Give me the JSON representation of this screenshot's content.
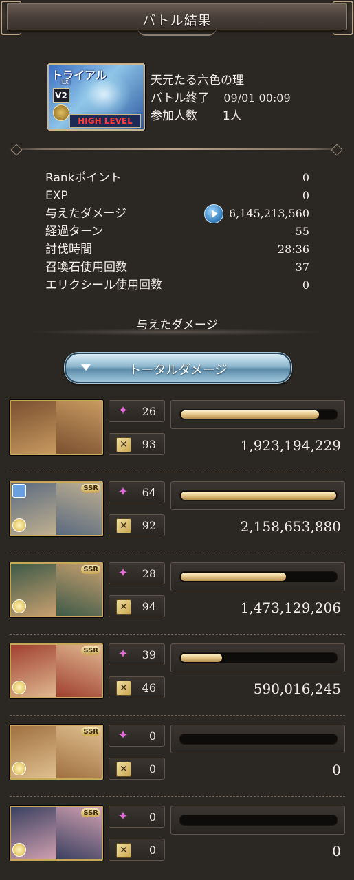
{
  "header": {
    "title": "バトル結果"
  },
  "quest": {
    "banner_trial": "トライアル",
    "banner_lx": "LX",
    "banner_v2": "V2",
    "banner_level": "HIGH LEVEL",
    "name": "天元たる六色の理",
    "end_label": "バトル終了",
    "end_value": "09/01 00:09",
    "participants_label": "参加人数",
    "participants_value": "1人"
  },
  "stats": [
    {
      "label": "Rankポイント",
      "value": "0"
    },
    {
      "label": "EXP",
      "value": "0"
    },
    {
      "label": "与えたダメージ",
      "value": "6,145,213,560"
    },
    {
      "label": "経過ターン",
      "value": "55"
    },
    {
      "label": "討伐時間",
      "value": "28:36"
    },
    {
      "label": "召喚石使用回数",
      "value": "37"
    },
    {
      "label": "エリクシール使用回数",
      "value": "0"
    }
  ],
  "damage_section": {
    "title": "与えたダメージ",
    "dropdown_label": "トータルダメージ"
  },
  "characters": [
    {
      "rarity": "",
      "star_count": "26",
      "cross_count": "93",
      "damage": "1,923,194,229",
      "bar_fraction": 0.89,
      "colors": [
        "#7a5030",
        "#c89a60"
      ]
    },
    {
      "rarity": "SSR",
      "star_count": "64",
      "cross_count": "92",
      "damage": "2,158,653,880",
      "bar_fraction": 1.0,
      "colors": [
        "#5a6a80",
        "#c0b090"
      ]
    },
    {
      "rarity": "SSR",
      "star_count": "28",
      "cross_count": "94",
      "damage": "1,473,129,206",
      "bar_fraction": 0.68,
      "colors": [
        "#3d5a48",
        "#c8a070"
      ]
    },
    {
      "rarity": "SSR",
      "star_count": "39",
      "cross_count": "46",
      "damage": "590,016,245",
      "bar_fraction": 0.27,
      "colors": [
        "#a04030",
        "#e0b890"
      ]
    },
    {
      "rarity": "SSR",
      "star_count": "0",
      "cross_count": "0",
      "damage": "0",
      "bar_fraction": 0.0,
      "colors": [
        "#a07040",
        "#e0c090"
      ]
    },
    {
      "rarity": "SSR",
      "star_count": "0",
      "cross_count": "0",
      "damage": "0",
      "bar_fraction": 0.0,
      "colors": [
        "#3a4060",
        "#d0a0b0"
      ]
    }
  ],
  "icons": {
    "star": "star-icon",
    "cross": "crossed-swords-icon",
    "play": "play-icon"
  }
}
